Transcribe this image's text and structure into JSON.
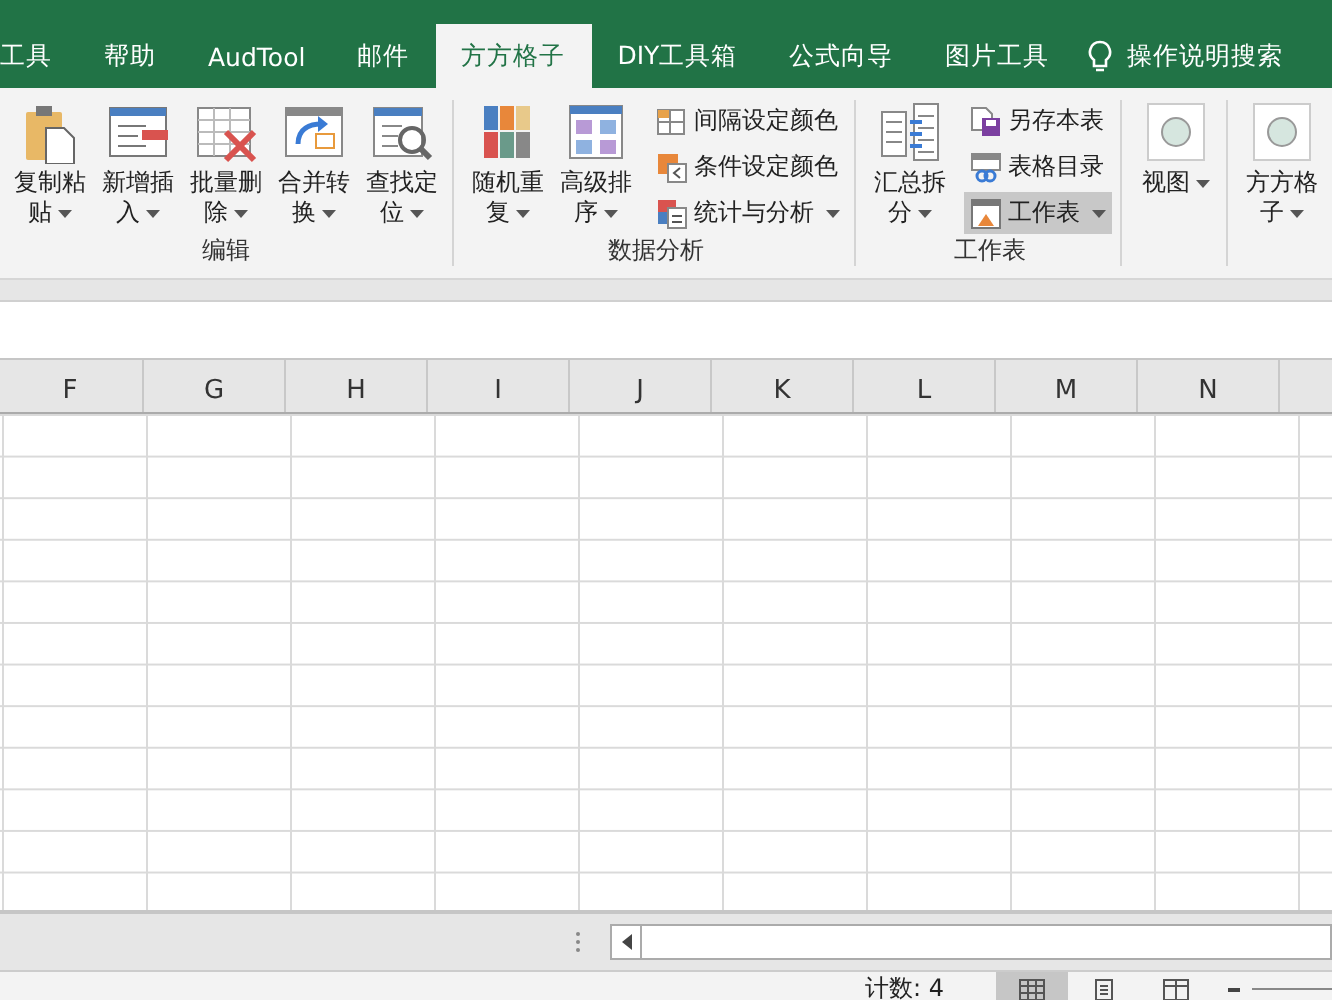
{
  "tabs": [
    {
      "label": "工具",
      "selected": false
    },
    {
      "label": "帮助",
      "selected": false
    },
    {
      "label": "AudTool",
      "selected": false
    },
    {
      "label": "邮件",
      "selected": false
    },
    {
      "label": "方方格子",
      "selected": true
    },
    {
      "label": "DIY工具箱",
      "selected": false
    },
    {
      "label": "公式向导",
      "selected": false
    },
    {
      "label": "图片工具",
      "selected": false
    }
  ],
  "tell_me": "操作说明搜索",
  "ribbon": {
    "groups": [
      {
        "title": "编辑",
        "items": [
          {
            "kind": "large",
            "label": "复制粘贴",
            "dropdown": true
          },
          {
            "kind": "large",
            "label": "新增插入",
            "dropdown": true
          },
          {
            "kind": "large",
            "label": "批量删除",
            "dropdown": true
          },
          {
            "kind": "large",
            "label": "合并转换",
            "dropdown": true
          },
          {
            "kind": "large",
            "label": "查找定位",
            "dropdown": true
          }
        ]
      },
      {
        "title": "数据分析",
        "items": [
          {
            "kind": "large",
            "label": "随机重复",
            "dropdown": true
          },
          {
            "kind": "large",
            "label": "高级排序",
            "dropdown": true
          },
          {
            "kind": "stack",
            "items": [
              {
                "label": "间隔设定颜色",
                "dropdown": false,
                "highlighted": false
              },
              {
                "label": "条件设定颜色",
                "dropdown": false,
                "highlighted": false
              },
              {
                "label": "统计与分析",
                "dropdown": true,
                "highlighted": false
              }
            ]
          }
        ]
      },
      {
        "title": "工作表",
        "items": [
          {
            "kind": "large",
            "label": "汇总拆分",
            "dropdown": true
          },
          {
            "kind": "stack",
            "items": [
              {
                "label": "另存本表",
                "dropdown": false,
                "highlighted": false
              },
              {
                "label": "表格目录",
                "dropdown": false,
                "highlighted": false
              },
              {
                "label": "工作表",
                "dropdown": true,
                "highlighted": true
              }
            ]
          }
        ]
      },
      {
        "items": [
          {
            "kind": "large",
            "label": "视图",
            "dropdown": true
          }
        ]
      },
      {
        "items": [
          {
            "kind": "large",
            "label": "方方格子",
            "dropdown": true
          }
        ]
      }
    ]
  },
  "columns": [
    "F",
    "G",
    "H",
    "I",
    "J",
    "K",
    "L",
    "M",
    "N"
  ],
  "status_bar": {
    "count": "计数: 4",
    "views": [
      {
        "selected": true
      },
      {
        "selected": false
      },
      {
        "selected": false
      }
    ]
  }
}
